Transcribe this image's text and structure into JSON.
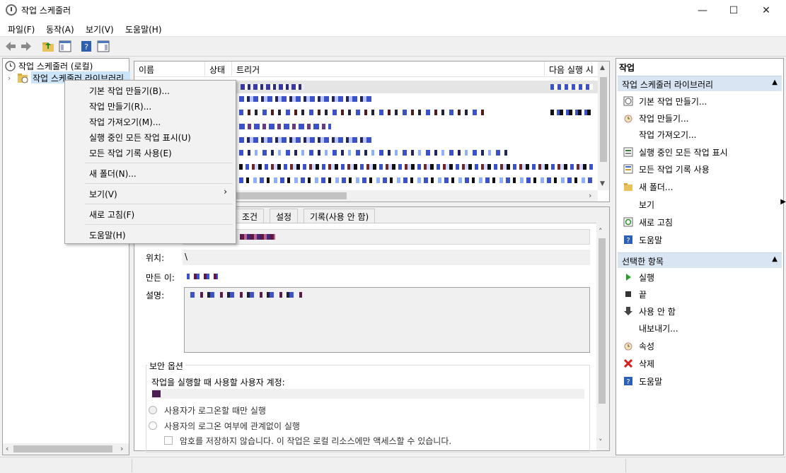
{
  "window": {
    "title": "작업 스케줄러",
    "min_icon": "minimize-icon",
    "max_icon": "maximize-icon",
    "close_icon": "close-icon"
  },
  "menubar": [
    "파일(F)",
    "동작(A)",
    "보기(V)",
    "도움말(H)"
  ],
  "tree": {
    "root": "작업 스케줄러 (로컬)",
    "library": "작업 스케줄러 라이브러리"
  },
  "task_list": {
    "columns": [
      "이름",
      "상태",
      "트리거",
      "다음 실행 시"
    ]
  },
  "context_menu": {
    "items": [
      "기본 작업 만들기(B)...",
      "작업 만들기(R)...",
      "작업 가져오기(M)...",
      "실행 중인 모든 작업 표시(U)",
      "모든 작업 기록 사용(E)",
      "새 폴더(N)...",
      "보기(V)",
      "새로 고침(F)",
      "도움말(H)"
    ],
    "submenu_arrow": "›"
  },
  "detail": {
    "tabs": [
      "조건",
      "설정",
      "기록(사용 안 함)"
    ],
    "location_label": "위치:",
    "location_value": "\\",
    "author_label": "만든 이:",
    "desc_label": "설명:",
    "security_title": "보안 옵션",
    "account_label": "작업을 실행할 때 사용할 사용자 계정:",
    "radio1": "사용자가 로그온할 때만 실행",
    "radio2": "사용자의 로그온 여부에 관계없이 실행",
    "checkbox": "암호를 저장하지 않습니다. 이 작업은 로컬 리소스에만 액세스할 수 있습니다."
  },
  "actions": {
    "title": "작업",
    "section1": "작업 스케줄러 라이브러리",
    "items1": [
      "기본 작업 만들기...",
      "작업 만들기...",
      "작업 가져오기...",
      "실행 중인 모든 작업 표시",
      "모든 작업 기록 사용",
      "새 폴더...",
      "보기",
      "새로 고침",
      "도움말"
    ],
    "section2": "선택한 항목",
    "items2": [
      "실행",
      "끝",
      "사용 안 함",
      "내보내기...",
      "속성",
      "삭제",
      "도움말"
    ]
  }
}
